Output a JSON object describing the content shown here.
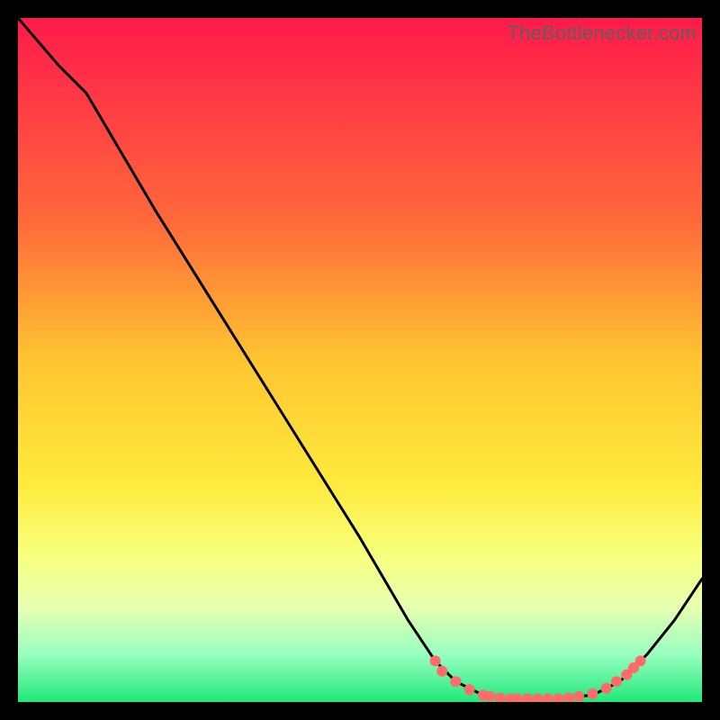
{
  "watermark": "TheBottlenecker.com",
  "chart_data": {
    "type": "line",
    "title": "",
    "xlabel": "",
    "ylabel": "",
    "xlim": [
      0,
      100
    ],
    "ylim": [
      0,
      100
    ],
    "grid": false,
    "legend": false,
    "gradient_stops": [
      {
        "offset": 0,
        "color": "#ff1a4b"
      },
      {
        "offset": 30,
        "color": "#ff6a3a"
      },
      {
        "offset": 50,
        "color": "#ffc531"
      },
      {
        "offset": 68,
        "color": "#feea3c"
      },
      {
        "offset": 78,
        "color": "#f8ff7a"
      },
      {
        "offset": 86,
        "color": "#e8ffb0"
      },
      {
        "offset": 93,
        "color": "#98ffc0"
      },
      {
        "offset": 100,
        "color": "#20e87a"
      }
    ],
    "curve": [
      {
        "x": 0,
        "y": 100
      },
      {
        "x": 6,
        "y": 93
      },
      {
        "x": 10,
        "y": 89
      },
      {
        "x": 20,
        "y": 72
      },
      {
        "x": 30,
        "y": 56
      },
      {
        "x": 40,
        "y": 40
      },
      {
        "x": 50,
        "y": 24
      },
      {
        "x": 57,
        "y": 12
      },
      {
        "x": 61,
        "y": 6
      },
      {
        "x": 64,
        "y": 3
      },
      {
        "x": 68,
        "y": 1
      },
      {
        "x": 72,
        "y": 0.5
      },
      {
        "x": 78,
        "y": 0.5
      },
      {
        "x": 84,
        "y": 1
      },
      {
        "x": 88,
        "y": 3
      },
      {
        "x": 92,
        "y": 7
      },
      {
        "x": 96,
        "y": 12
      },
      {
        "x": 100,
        "y": 18
      }
    ],
    "marker_points": [
      {
        "x": 61,
        "y": 6.0
      },
      {
        "x": 62,
        "y": 4.5
      },
      {
        "x": 64,
        "y": 3.0
      },
      {
        "x": 66,
        "y": 1.8
      },
      {
        "x": 68,
        "y": 1.0
      },
      {
        "x": 69,
        "y": 0.8
      },
      {
        "x": 70.5,
        "y": 0.6
      },
      {
        "x": 72,
        "y": 0.5
      },
      {
        "x": 73,
        "y": 0.5
      },
      {
        "x": 74.5,
        "y": 0.5
      },
      {
        "x": 76,
        "y": 0.5
      },
      {
        "x": 77.5,
        "y": 0.5
      },
      {
        "x": 79,
        "y": 0.5
      },
      {
        "x": 80.5,
        "y": 0.6
      },
      {
        "x": 82,
        "y": 0.8
      },
      {
        "x": 84,
        "y": 1.2
      },
      {
        "x": 86,
        "y": 2.0
      },
      {
        "x": 87.5,
        "y": 3.0
      },
      {
        "x": 89,
        "y": 4.0
      },
      {
        "x": 90,
        "y": 5.0
      },
      {
        "x": 91,
        "y": 6.0
      }
    ],
    "marker_color": "#ff6a6a",
    "curve_color": "#000000"
  }
}
